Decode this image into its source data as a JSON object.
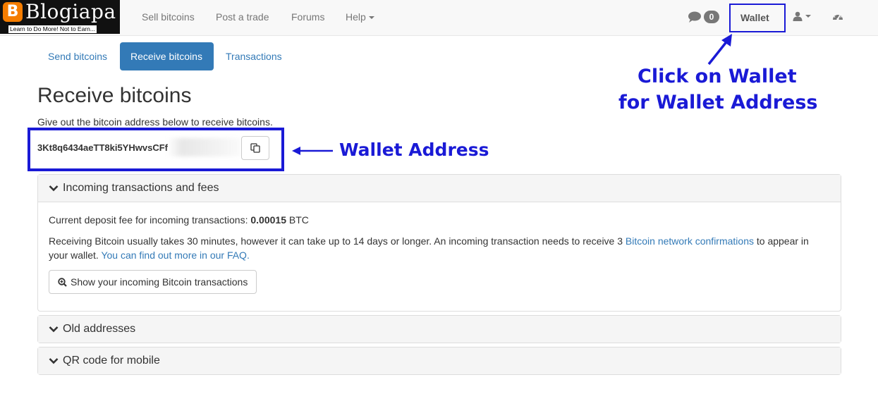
{
  "logo": {
    "letter": "B",
    "name": "Blogiapa",
    "tagline": "Learn to Do More! Not to Earn..."
  },
  "nav": {
    "sell": "Sell bitcoins",
    "post": "Post a trade",
    "forums": "Forums",
    "help": "Help",
    "messages_count": "0",
    "wallet": "Wallet"
  },
  "tabs": {
    "send": "Send bitcoins",
    "receive": "Receive bitcoins",
    "transactions": "Transactions"
  },
  "page": {
    "title": "Receive bitcoins",
    "intro": "Give out the bitcoin address below to receive bitcoins.",
    "address": "3Kt8q6434aeTT8ki5YHwvsCFf"
  },
  "annotations": {
    "wallet_line1": "Click on Wallet",
    "wallet_line2": "for Wallet Address",
    "address": "Wallet Address",
    "color": "#1a1ad6"
  },
  "panels": {
    "incoming": {
      "title": "Incoming transactions and fees",
      "fee_label": "Current deposit fee for incoming transactions: ",
      "fee_value": "0.00015",
      "fee_unit": " BTC",
      "text1": "Receiving Bitcoin usually takes 30 minutes, however it can take up to 14 days or longer. An incoming transaction needs to receive 3 ",
      "link1": "Bitcoin network confirmations",
      "text2": " to appear in your wallet. ",
      "link2": "You can find out more in our FAQ.",
      "button": "Show your incoming Bitcoin transactions"
    },
    "old": {
      "title": "Old addresses"
    },
    "qr": {
      "title": "QR code for mobile"
    }
  }
}
